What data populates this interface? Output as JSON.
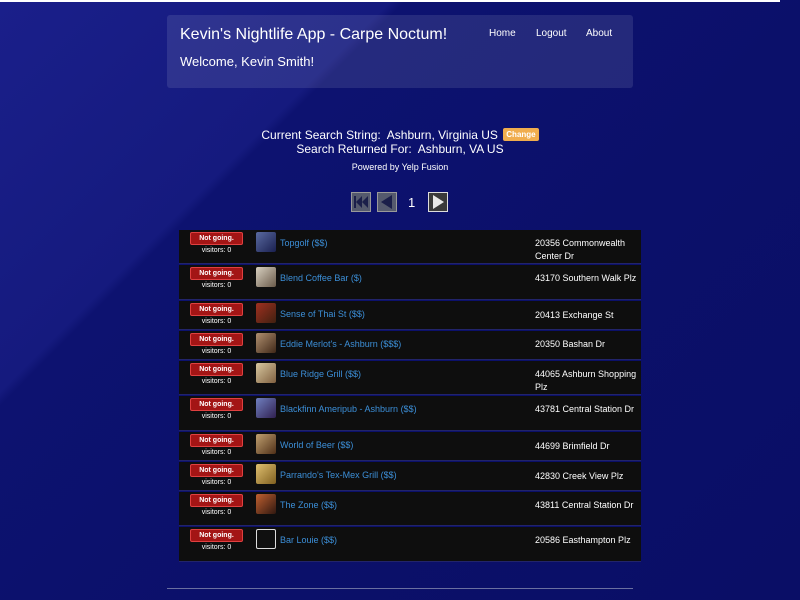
{
  "header": {
    "title": "Kevin's Nightlife App - Carpe Noctum!",
    "welcome": "Welcome, Kevin Smith!",
    "nav": {
      "home": "Home",
      "logout": "Logout",
      "about": "About"
    }
  },
  "search": {
    "current_label": "Current Search String:",
    "current_value": "Ashburn, Virginia US",
    "change_label": "Change",
    "returned_label": "Search Returned For:",
    "returned_value": "Ashburn, VA US",
    "powered_by": "Powered by Yelp Fusion"
  },
  "pager": {
    "page": "1"
  },
  "results": [
    {
      "status": "Not going.",
      "visitors": "visitors: 0",
      "name": "Topgolf ($$)",
      "address": "20356 Commonwealth Center Dr"
    },
    {
      "status": "Not going.",
      "visitors": "visitors: 0",
      "name": "Blend Coffee Bar ($)",
      "address": "43170 Southern Walk Plz"
    },
    {
      "status": "Not going.",
      "visitors": "visitors: 0",
      "name": "Sense of Thai St ($$)",
      "address": "20413 Exchange St"
    },
    {
      "status": "Not going.",
      "visitors": "visitors: 0",
      "name": "Eddie Merlot's - Ashburn ($$$)",
      "address": "20350 Bashan Dr"
    },
    {
      "status": "Not going.",
      "visitors": "visitors: 0",
      "name": "Blue Ridge Grill ($$)",
      "address": "44065 Ashburn Shopping Plz"
    },
    {
      "status": "Not going.",
      "visitors": "visitors: 0",
      "name": "Blackfinn Ameripub - Ashburn ($$)",
      "address": "43781 Central Station Dr"
    },
    {
      "status": "Not going.",
      "visitors": "visitors: 0",
      "name": "World of Beer ($$)",
      "address": "44699 Brimfield Dr"
    },
    {
      "status": "Not going.",
      "visitors": "visitors: 0",
      "name": "Parrando's Tex-Mex Grill ($$)",
      "address": "42830 Creek View Plz"
    },
    {
      "status": "Not going.",
      "visitors": "visitors: 0",
      "name": "The Zone ($$)",
      "address": "43811 Central Station Dr"
    },
    {
      "status": "Not going.",
      "visitors": "visitors: 0",
      "name": "Bar Louie ($$)",
      "address": "20586 Easthampton Plz"
    }
  ],
  "colors": {
    "link": "#3c8fd8",
    "not_going": "#a31515",
    "change": "#f0ad4e"
  }
}
